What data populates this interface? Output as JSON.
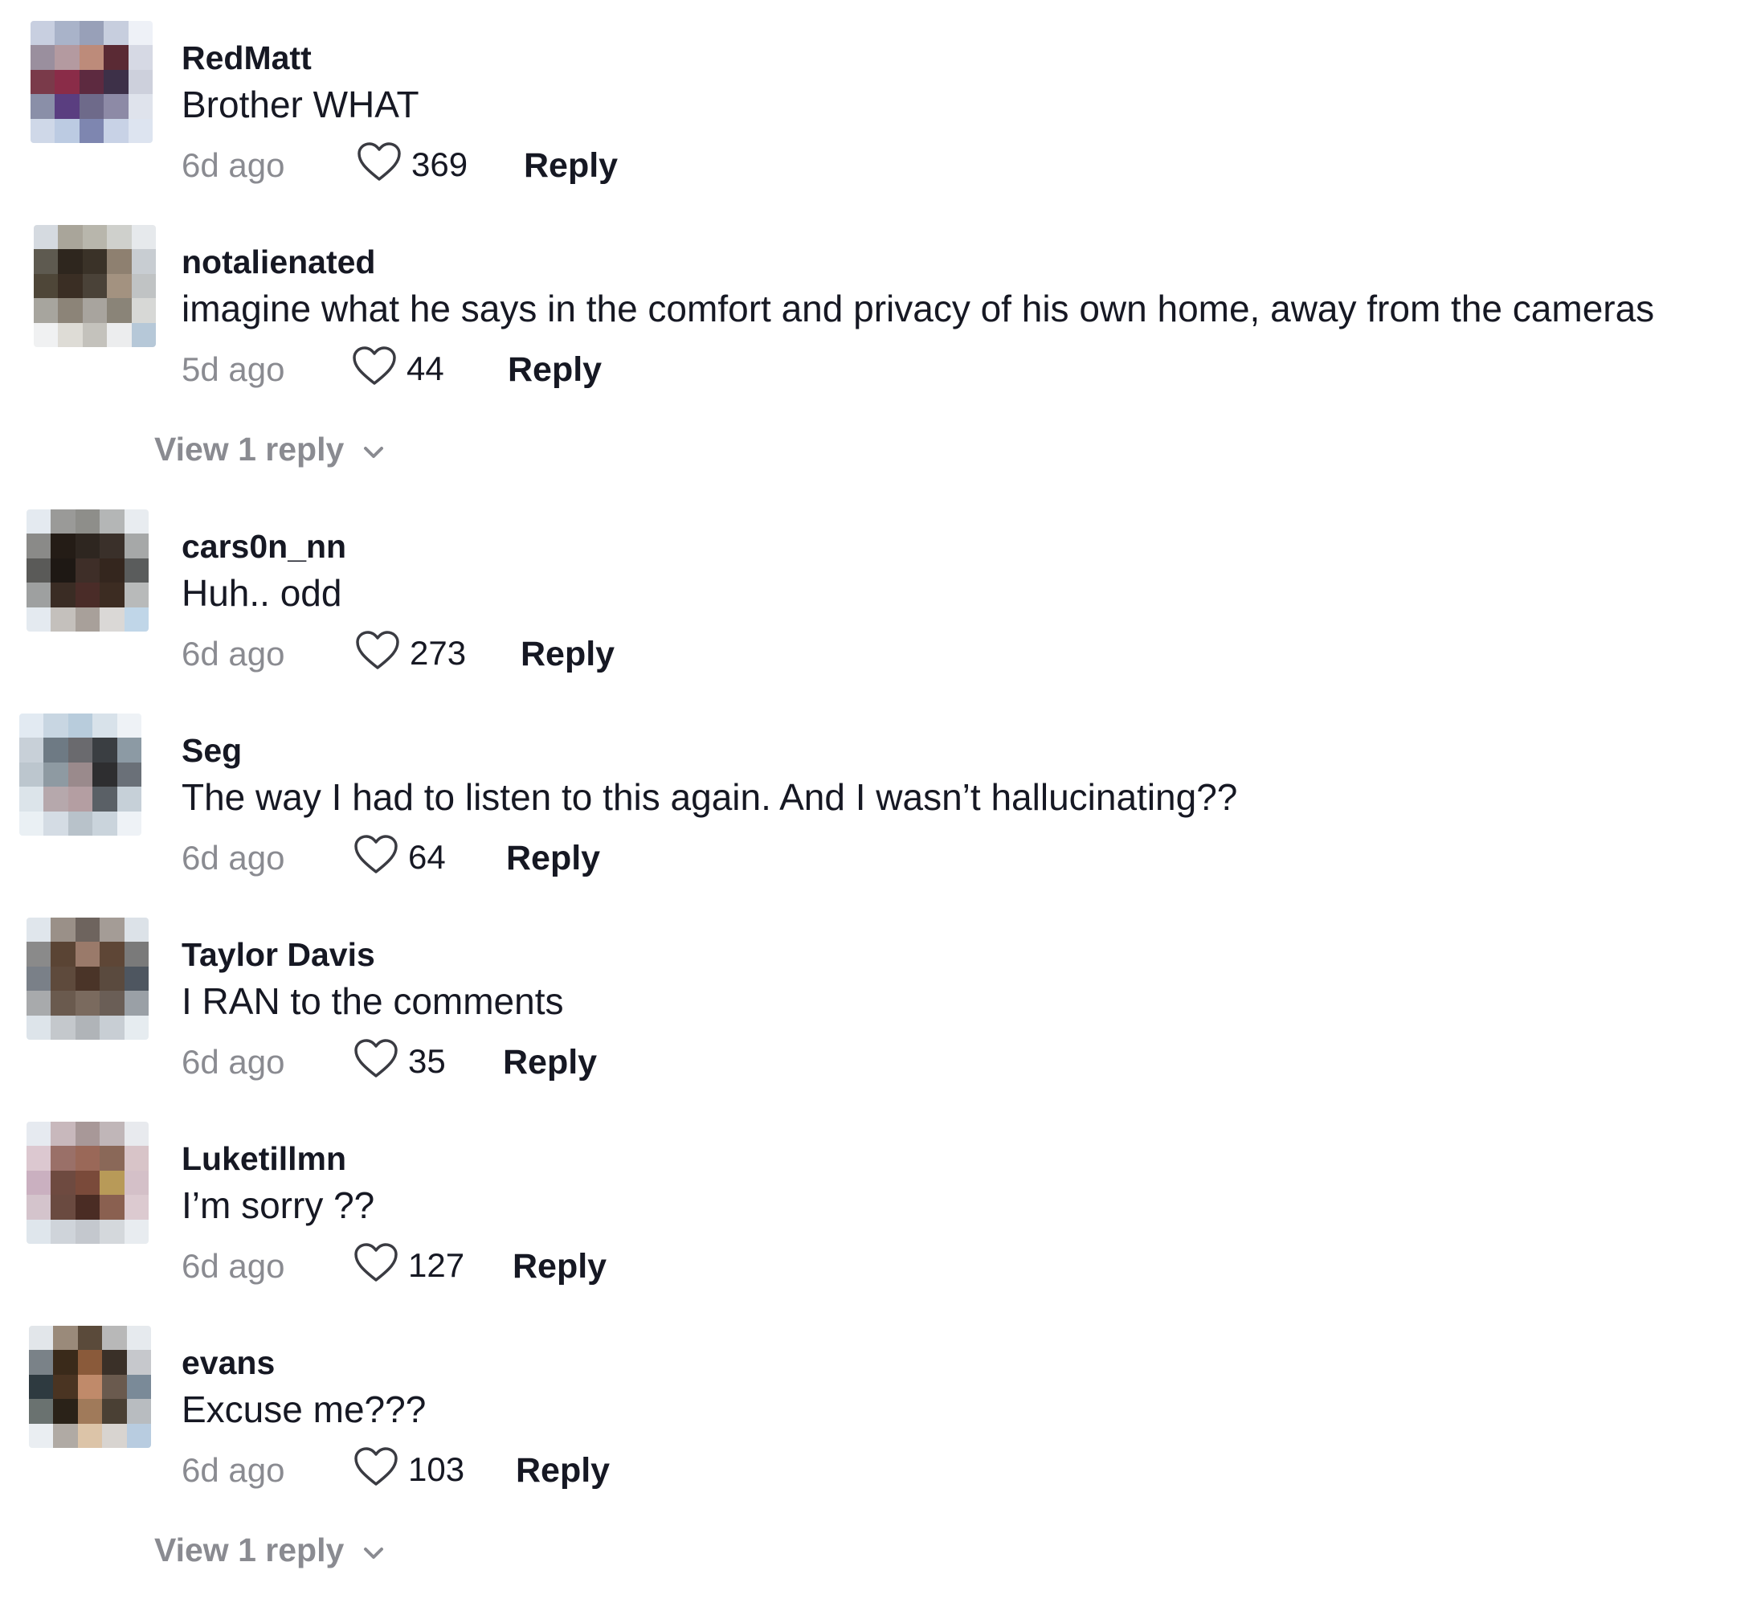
{
  "comments": [
    {
      "username": "RedMatt",
      "text": "Brother WHAT",
      "time": "6d ago",
      "likes": "369",
      "reply_label": "Reply",
      "avatar_colors": [
        "#c8cfe0",
        "#a9b3c9",
        "#98a0b8",
        "#c7cede",
        "#eef1f7",
        "#9a8f9e",
        "#b49aa0",
        "#bd8b7a",
        "#5a2a34",
        "#d6d9e4",
        "#7a3a4a",
        "#8a2c48",
        "#5d2a40",
        "#3d3048",
        "#cdd0dc",
        "#8a8fa8",
        "#5a3e80",
        "#6e6a8a",
        "#8d8aa6",
        "#dfe3ec",
        "#cfd8e8",
        "#bccbe2",
        "#7e86b0",
        "#c8d2e6",
        "#dde4f0"
      ]
    },
    {
      "username": "notalienated",
      "text": "imagine what he says in the comfort and privacy of his own home, away from the cameras",
      "time": "5d ago",
      "likes": "44",
      "reply_label": "Reply",
      "view_replies": "View 1 reply",
      "avatar_colors": [
        "#d5dae0",
        "#a9a59a",
        "#b8b6ac",
        "#cfd0cc",
        "#e6e9ec",
        "#5e5a50",
        "#2e261e",
        "#3a3228",
        "#8e8070",
        "#c8cdd2",
        "#4e4638",
        "#3a2e24",
        "#4a4238",
        "#a39280",
        "#c0c3c4",
        "#a7a59e",
        "#8c8478",
        "#a8a49e",
        "#8a8478",
        "#d7d8d6",
        "#f0f1f2",
        "#dedcd6",
        "#c4c2bc",
        "#ecedee",
        "#b6c8d8"
      ]
    },
    {
      "username": "cars0n_nn",
      "text": "Huh.. odd",
      "time": "6d ago",
      "likes": "273",
      "reply_label": "Reply",
      "avatar_colors": [
        "#e4eaf0",
        "#9a9a98",
        "#8e8e8a",
        "#b4b6b6",
        "#e8ecf0",
        "#8a8a88",
        "#241c16",
        "#2e2620",
        "#3a302a",
        "#a6a8a8",
        "#5a5a58",
        "#1e1814",
        "#3e2e28",
        "#34261e",
        "#5a5c5c",
        "#9ea0a0",
        "#3a2c24",
        "#4a2c28",
        "#3c2c22",
        "#b8baba",
        "#e4eaf0",
        "#c4c0bc",
        "#a8a09a",
        "#dad8d6",
        "#c0d6e8"
      ]
    },
    {
      "username": "Seg",
      "text": "The way I had to listen to this again. And I wasn’t hallucinating??",
      "time": "6d ago",
      "likes": "64",
      "reply_label": "Reply",
      "avatar_colors": [
        "#e2eaf2",
        "#c8d6e2",
        "#b8ccdc",
        "#d8e2ea",
        "#eef2f6",
        "#c8d0d8",
        "#6e7a84",
        "#6a6a6e",
        "#3a3e42",
        "#8c9aa4",
        "#bcc6ce",
        "#8e9aa2",
        "#9a8a8c",
        "#2e2e30",
        "#6a7078",
        "#dce4ea",
        "#b6a8ac",
        "#b49ea2",
        "#5a6066",
        "#c6d0d8",
        "#eaf0f4",
        "#d4dce4",
        "#b8c2ca",
        "#cad4dc",
        "#eef2f6"
      ]
    },
    {
      "username": "Taylor Davis",
      "text": "I RAN to the comments",
      "time": "6d ago",
      "likes": "35",
      "reply_label": "Reply",
      "avatar_colors": [
        "#e0e6ec",
        "#9a9088",
        "#6e645e",
        "#a49c96",
        "#dce2e8",
        "#8a8a8a",
        "#5a4434",
        "#9a7a6a",
        "#5e4636",
        "#7a7a7a",
        "#7a8088",
        "#5e4a3c",
        "#4a3428",
        "#5a4a3e",
        "#4e5660",
        "#a8aaac",
        "#6a5a4e",
        "#7a6a5e",
        "#6a5e56",
        "#9aa0a6",
        "#dde4ea",
        "#c4c8cc",
        "#b0b4b8",
        "#c8ced4",
        "#e6ecf0"
      ]
    },
    {
      "username": "Luketillmn",
      "text": "I’m sorry ??",
      "time": "6d ago",
      "likes": "127",
      "reply_label": "Reply",
      "avatar_colors": [
        "#e6eaf0",
        "#c8b8bc",
        "#a89898",
        "#c0b6b8",
        "#e8eaee",
        "#dcc8d0",
        "#9a7068",
        "#9a6858",
        "#8a6858",
        "#d8c4c8",
        "#cab0c0",
        "#6e4a40",
        "#7a4a3a",
        "#b89a58",
        "#d4c0c8",
        "#d4c4cc",
        "#6a4a40",
        "#4a2c24",
        "#8a6050",
        "#dccad0",
        "#dfe6ec",
        "#cfd4da",
        "#c4c8ce",
        "#d4d8dc",
        "#e8ecf0"
      ]
    },
    {
      "username": "evans",
      "text": "Excuse me???",
      "time": "6d ago",
      "likes": "103",
      "reply_label": "Reply",
      "view_replies": "View 1 reply",
      "avatar_colors": [
        "#e2e6ea",
        "#9a8a7a",
        "#5a4a3a",
        "#b8b8b8",
        "#e6eaee",
        "#7a8288",
        "#3a2a1a",
        "#8a5a3a",
        "#3a3028",
        "#c6c8cc",
        "#2e3a40",
        "#4a3422",
        "#c08a6a",
        "#6a5a4e",
        "#7a8a98",
        "#6a7270",
        "#2a2218",
        "#a07a5a",
        "#4a4034",
        "#b8bcc0",
        "#eaeef2",
        "#b0aaa4",
        "#dcc4a8",
        "#d8d4d0",
        "#b8cce0"
      ]
    }
  ]
}
